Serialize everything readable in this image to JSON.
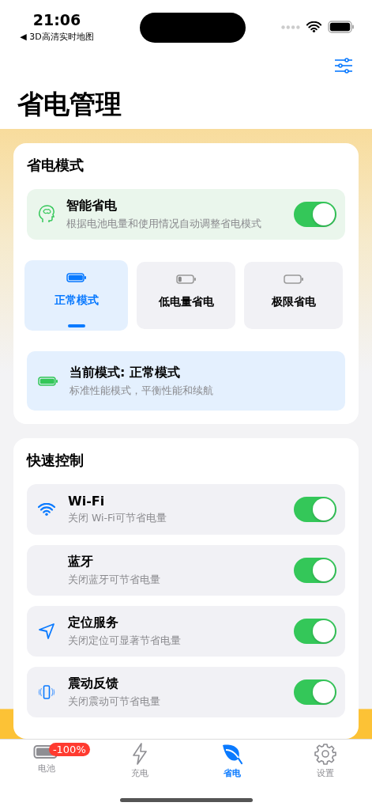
{
  "status_bar": {
    "time": "21:06",
    "back_label": "◀ 3D高清实时地图"
  },
  "title": "省电管理",
  "power_mode_card": {
    "title": "省电模式",
    "smart_saving": {
      "label": "智能省电",
      "description": "根据电池电量和使用情况自动调整省电模式",
      "on": true
    },
    "modes": [
      {
        "kind": "normal",
        "label": "正常模式",
        "selected": true
      },
      {
        "kind": "low",
        "label": "低电量省电",
        "selected": false
      },
      {
        "kind": "extreme",
        "label": "极限省电",
        "selected": false
      }
    ],
    "current": {
      "label": "当前模式: 正常模式",
      "description": "标准性能模式，平衡性能和续航"
    }
  },
  "quick_control": {
    "title": "快速控制",
    "items": [
      {
        "kind": "wifi",
        "label": "Wi-Fi",
        "description": "关闭 Wi-Fi可节省电量",
        "on": true
      },
      {
        "kind": "bluetooth",
        "label": "蓝牙",
        "description": "关闭蓝牙可节省电量",
        "on": true
      },
      {
        "kind": "location",
        "label": "定位服务",
        "description": "关闭定位可显著节省电量",
        "on": true
      },
      {
        "kind": "vibration",
        "label": "震动反馈",
        "description": "关闭震动可节省电量",
        "on": true
      }
    ]
  },
  "tab_bar": {
    "items": [
      {
        "kind": "battery",
        "label": "电池",
        "badge": "-100%",
        "selected": false
      },
      {
        "kind": "charge",
        "label": "充电",
        "selected": false
      },
      {
        "kind": "saving",
        "label": "省电",
        "selected": true
      },
      {
        "kind": "settings",
        "label": "设置",
        "selected": false
      }
    ]
  }
}
